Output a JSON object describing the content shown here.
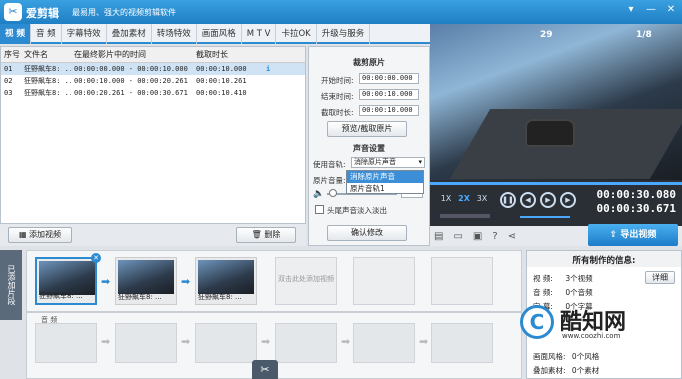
{
  "app": {
    "name": "爱剪辑",
    "slogan": "最易用、强大的视频剪辑软件",
    "logo": "logo-icon"
  },
  "tabs": [
    "视 频",
    "音 频",
    "字幕特效",
    "叠加素材",
    "转场特效",
    "画面风格",
    "M T V",
    "卡拉OK",
    "升级与服务"
  ],
  "table": {
    "headers": [
      "序号",
      "文件名",
      "在最终影片中的时间",
      "截取时长"
    ],
    "rows": [
      {
        "no": "01",
        "name": "狂野飙车8: ...",
        "time": "00:00:00.000 - 00:00:10.000",
        "dur": "00:00:10.000"
      },
      {
        "no": "02",
        "name": "狂野飙车8: ...",
        "time": "00:00:10.000 - 00:00:20.261",
        "dur": "00:00:10.261"
      },
      {
        "no": "03",
        "name": "狂野飙车8: ...",
        "time": "00:00:20.261 - 00:00:30.671",
        "dur": "00:00:10.410"
      }
    ]
  },
  "list_buttons": {
    "add": "添加视频",
    "delete": "删除"
  },
  "clip_panel": {
    "section1": "裁剪原片",
    "start_label": "开始时间:",
    "start": "00:00:00.000",
    "end_label": "结束时间:",
    "end": "00:00:10.000",
    "dur_label": "截取时长:",
    "dur": "00:00:10.000",
    "preview_btn": "预览/截取原片",
    "section2": "声音设置",
    "track_label": "使用音轨:",
    "track": "消除原片声音",
    "vol_label": "原片音量:",
    "vol_value": "%",
    "fade": "头尾声音淡入淡出",
    "confirm": "确认修改",
    "options": [
      "消除原片声音",
      "原片音轨1"
    ]
  },
  "player": {
    "hud_left": "29",
    "hud_right": "1/8",
    "speeds": [
      "1X",
      "2X",
      "3X"
    ],
    "time_current": "00:00:30.080",
    "time_total": "00:00:30.671"
  },
  "export_btn": "导出视频",
  "timeline": {
    "side_label": "已添加片段",
    "clips": [
      "狂野飙车8: ...",
      "狂野飙车8: ...",
      "狂野飙车8: ..."
    ],
    "empty_hint": "双击此处添加视频",
    "audio_label": "音 频"
  },
  "info": {
    "title": "所有制作的信息:",
    "rows": [
      {
        "k": "视  频:",
        "v": "3个视频",
        "btn": "详细"
      },
      {
        "k": "音  频:",
        "v": "0个音频"
      },
      {
        "k": "字  幕:",
        "v": "0个字幕"
      },
      {
        "k": "画面风格:",
        "v": "0个风格"
      },
      {
        "k": "叠加素材:",
        "v": "0个素材"
      }
    ]
  },
  "watermark": {
    "logo": "C",
    "text": "酷知网",
    "url": "www.coozhi.com"
  }
}
